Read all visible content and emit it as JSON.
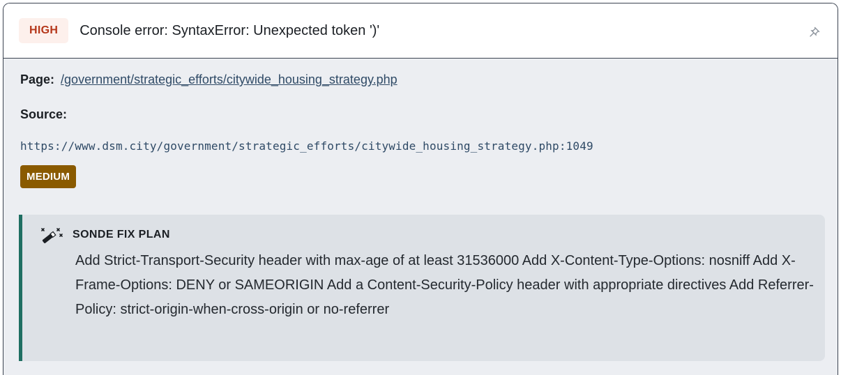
{
  "issue": {
    "severity": "HIGH",
    "title": "Console error: SyntaxError: Unexpected token ')'",
    "pin_icon": "pin-icon"
  },
  "details": {
    "page_label": "Page:",
    "page_link": "/government/strategic_efforts/citywide_housing_strategy.php",
    "source_label": "Source:",
    "source_url": "https://www.dsm.city/government/strategic_efforts/citywide_housing_strategy.php:1049",
    "source_severity": "MEDIUM"
  },
  "fix_plan": {
    "icon": "magic-wand-icon",
    "title": "SONDE FIX PLAN",
    "text": "Add Strict-Transport-Security header with max-age of at least 31536000 Add X-Content-Type-Options: nosniff Add X-Frame-Options: DENY or SAMEORIGIN Add a Content-Security-Policy header with appropriate directives Add Referrer-Policy: strict-origin-when-cross-origin or no-referrer"
  },
  "colors": {
    "high_badge_text": "#b5371a",
    "high_badge_bg": "#fdf0ec",
    "medium_badge_bg": "#8a5a00",
    "fix_accent": "#1f6e62",
    "link": "#2f4a66"
  }
}
